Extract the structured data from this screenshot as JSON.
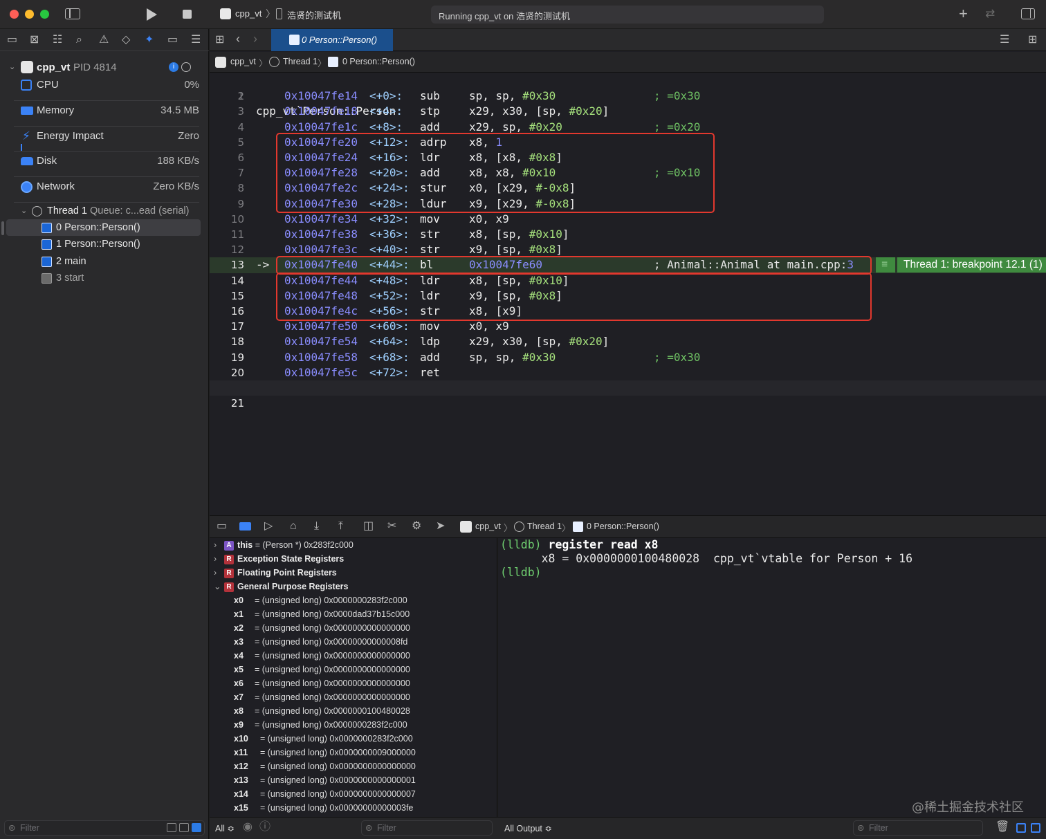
{
  "titlebar": {
    "scheme": "cpp_vt",
    "device": "浩贤的测试机",
    "status": "Running cpp_vt on 浩贤的测试机"
  },
  "editor_tab": {
    "label": "0 Person::Person()"
  },
  "jumpbar": {
    "project": "cpp_vt",
    "thread": "Thread 1",
    "frame": "0 Person::Person()"
  },
  "sidebar": {
    "process": {
      "name": "cpp_vt",
      "pid": "PID 4814"
    },
    "gauges": [
      {
        "label": "CPU",
        "value": "0%"
      },
      {
        "label": "Memory",
        "value": "34.5 MB"
      },
      {
        "label": "Energy Impact",
        "value": "Zero"
      },
      {
        "label": "Disk",
        "value": "188 KB/s"
      },
      {
        "label": "Network",
        "value": "Zero KB/s"
      }
    ],
    "thread": {
      "name": "Thread 1",
      "queue": "Queue: c...ead (serial)"
    },
    "frames": [
      "0 Person::Person()",
      "1 Person::Person()",
      "2 main",
      "3 start"
    ],
    "filter_placeholder": "Filter"
  },
  "code": {
    "title": "cpp_vt`Person::Person:",
    "lines": [
      {
        "n": "2",
        "addr": "0x10047fe14",
        "off": "<+0>:",
        "mn": "sub",
        "ops": [
          [
            "op",
            "sp, sp, "
          ],
          [
            "num",
            "#0x30"
          ]
        ],
        "cmt": "; =0x30"
      },
      {
        "n": "3",
        "addr": "0x10047fe18",
        "off": "<+4>:",
        "mn": "stp",
        "ops": [
          [
            "op",
            "x29, x30, [sp, "
          ],
          [
            "num",
            "#0x20"
          ],
          [
            "op",
            "]"
          ]
        ],
        "cmt": ""
      },
      {
        "n": "4",
        "addr": "0x10047fe1c",
        "off": "<+8>:",
        "mn": "add",
        "ops": [
          [
            "op",
            "x29, sp, "
          ],
          [
            "num",
            "#0x20"
          ]
        ],
        "cmt": "; =0x20"
      },
      {
        "n": "5",
        "addr": "0x10047fe20",
        "off": "<+12>:",
        "mn": "adrp",
        "ops": [
          [
            "op",
            "x8, "
          ],
          [
            "addr",
            "1"
          ]
        ],
        "cmt": ""
      },
      {
        "n": "6",
        "addr": "0x10047fe24",
        "off": "<+16>:",
        "mn": "ldr",
        "ops": [
          [
            "op",
            "x8, [x8, "
          ],
          [
            "num",
            "#0x8"
          ],
          [
            "op",
            "]"
          ]
        ],
        "cmt": ""
      },
      {
        "n": "7",
        "addr": "0x10047fe28",
        "off": "<+20>:",
        "mn": "add",
        "ops": [
          [
            "op",
            "x8, x8, "
          ],
          [
            "num",
            "#0x10"
          ]
        ],
        "cmt": "; =0x10"
      },
      {
        "n": "8",
        "addr": "0x10047fe2c",
        "off": "<+24>:",
        "mn": "stur",
        "ops": [
          [
            "op",
            "x0, [x29, "
          ],
          [
            "num",
            "#-0x8"
          ],
          [
            "op",
            "]"
          ]
        ],
        "cmt": ""
      },
      {
        "n": "9",
        "addr": "0x10047fe30",
        "off": "<+28>:",
        "mn": "ldur",
        "ops": [
          [
            "op",
            "x9, [x29, "
          ],
          [
            "num",
            "#-0x8"
          ],
          [
            "op",
            "]"
          ]
        ],
        "cmt": ""
      },
      {
        "n": "10",
        "addr": "0x10047fe34",
        "off": "<+32>:",
        "mn": "mov",
        "ops": [
          [
            "op",
            "x0, x9"
          ]
        ],
        "cmt": ""
      },
      {
        "n": "11",
        "addr": "0x10047fe38",
        "off": "<+36>:",
        "mn": "str",
        "ops": [
          [
            "op",
            "x8, [sp, "
          ],
          [
            "num",
            "#0x10"
          ],
          [
            "op",
            "]"
          ]
        ],
        "cmt": ""
      },
      {
        "n": "12",
        "addr": "0x10047fe3c",
        "off": "<+40>:",
        "mn": "str",
        "ops": [
          [
            "op",
            "x9, [sp, "
          ],
          [
            "num",
            "#0x8"
          ],
          [
            "op",
            "]"
          ]
        ],
        "cmt": ""
      },
      {
        "n": "13",
        "addr": "0x10047fe40",
        "off": "<+44>:",
        "mn": "bl",
        "ops": [
          [
            "addr",
            "0x10047fe60"
          ]
        ],
        "cmt": "; Animal::Animal at main.cpp:3",
        "current": true
      },
      {
        "n": "14",
        "addr": "0x10047fe44",
        "off": "<+48>:",
        "mn": "ldr",
        "ops": [
          [
            "op",
            "x8, [sp, "
          ],
          [
            "num",
            "#0x10"
          ],
          [
            "op",
            "]"
          ]
        ],
        "cmt": ""
      },
      {
        "n": "15",
        "addr": "0x10047fe48",
        "off": "<+52>:",
        "mn": "ldr",
        "ops": [
          [
            "op",
            "x9, [sp, "
          ],
          [
            "num",
            "#0x8"
          ],
          [
            "op",
            "]"
          ]
        ],
        "cmt": ""
      },
      {
        "n": "16",
        "addr": "0x10047fe4c",
        "off": "<+56>:",
        "mn": "str",
        "ops": [
          [
            "op",
            "x8, [x9]"
          ]
        ],
        "cmt": ""
      },
      {
        "n": "17",
        "addr": "0x10047fe50",
        "off": "<+60>:",
        "mn": "mov",
        "ops": [
          [
            "op",
            "x0, x9"
          ]
        ],
        "cmt": ""
      },
      {
        "n": "18",
        "addr": "0x10047fe54",
        "off": "<+64>:",
        "mn": "ldp",
        "ops": [
          [
            "op",
            "x29, x30, [sp, "
          ],
          [
            "num",
            "#0x20"
          ],
          [
            "op",
            "]"
          ]
        ],
        "cmt": ""
      },
      {
        "n": "19",
        "addr": "0x10047fe58",
        "off": "<+68>:",
        "mn": "add",
        "ops": [
          [
            "op",
            "sp, sp, "
          ],
          [
            "num",
            "#0x30"
          ]
        ],
        "cmt": "; =0x30"
      },
      {
        "n": "20",
        "addr": "0x10047fe5c",
        "off": "<+72>:",
        "mn": "ret",
        "ops": [],
        "cmt": ""
      }
    ],
    "last_line": "21",
    "pc_arrow": "->",
    "breakpoint_label": "Thread 1: breakpoint 12.1 (1)"
  },
  "variables": {
    "top": [
      {
        "badge": "A",
        "name": "this",
        "value": "= (Person *) 0x283f2c000"
      },
      {
        "badge": "R",
        "name": "Exception State Registers",
        "value": ""
      },
      {
        "badge": "R",
        "name": "Floating Point Registers",
        "value": ""
      },
      {
        "badge": "R",
        "name": "General Purpose Registers",
        "value": ""
      }
    ],
    "registers": [
      {
        "name": "x0",
        "value": "= (unsigned long) 0x0000000283f2c000"
      },
      {
        "name": "x1",
        "value": "= (unsigned long) 0x0000dad37b15c000"
      },
      {
        "name": "x2",
        "value": "= (unsigned long) 0x0000000000000000"
      },
      {
        "name": "x3",
        "value": "= (unsigned long) 0x00000000000008fd"
      },
      {
        "name": "x4",
        "value": "= (unsigned long) 0x0000000000000000"
      },
      {
        "name": "x5",
        "value": "= (unsigned long) 0x0000000000000000"
      },
      {
        "name": "x6",
        "value": "= (unsigned long) 0x0000000000000000"
      },
      {
        "name": "x7",
        "value": "= (unsigned long) 0x0000000000000000"
      },
      {
        "name": "x8",
        "value": "= (unsigned long) 0x0000000100480028"
      },
      {
        "name": "x9",
        "value": "= (unsigned long) 0x0000000283f2c000"
      },
      {
        "name": "x10",
        "value": "= (unsigned long) 0x0000000283f2c000"
      },
      {
        "name": "x11",
        "value": "= (unsigned long) 0x0000000009000000"
      },
      {
        "name": "x12",
        "value": "= (unsigned long) 0x0000000000000000"
      },
      {
        "name": "x13",
        "value": "= (unsigned long) 0x0000000000000001"
      },
      {
        "name": "x14",
        "value": "= (unsigned long) 0x0000000000000007"
      },
      {
        "name": "x15",
        "value": "= (unsigned long) 0x00000000000003fe"
      }
    ]
  },
  "console": {
    "prompt": "(lldb)",
    "command": "register read x8",
    "output": "      x8 = 0x0000000100480028  cpp_vt`vtable for Person + 16",
    "prompt2": "(lldb)"
  },
  "bottombar": {
    "scope": "All ≎",
    "var_filter": "Filter",
    "output_scope": "All Output ≎",
    "console_filter": "Filter"
  },
  "watermark": "@稀土掘金技术社区",
  "colors": {
    "accent": "#1b66d6",
    "highlight_box": "#e2382e",
    "pc_line": "#2b3a2b",
    "breakpoint": "#3f8a3f"
  }
}
